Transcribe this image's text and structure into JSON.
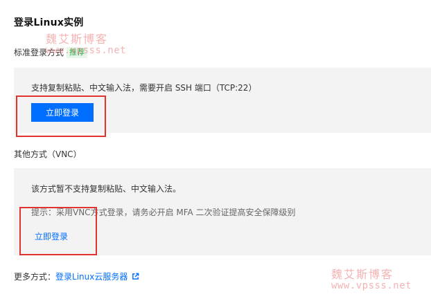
{
  "page": {
    "title": "登录Linux实例"
  },
  "standard": {
    "label": "标准登录方式",
    "badge": "推荐",
    "description": "支持复制粘贴、中文输入法，需要开启 SSH 端口（TCP:22）",
    "login_button": "立即登录"
  },
  "vnc": {
    "label": "其他方式（VNC）",
    "description": "该方式暂不支持复制粘贴、中文输入法。",
    "tip": "提示：采用VNC方式登录，请务必开启 MFA 二次验证提高安全保障级别",
    "login_link": "立即登录"
  },
  "more": {
    "prefix": "更多方式：",
    "link": "登录Linux云服务器",
    "icon": "external-link-icon"
  },
  "watermark": {
    "name": "魏艾斯博客",
    "url": "www.vpsss.net"
  },
  "colors": {
    "primary": "#006eff",
    "highlight": "#e0332f",
    "badge_bg": "#e6f6e9",
    "badge_text": "#29a745",
    "panel_bg": "#f3f3f3",
    "watermark": "#f08a8a"
  }
}
